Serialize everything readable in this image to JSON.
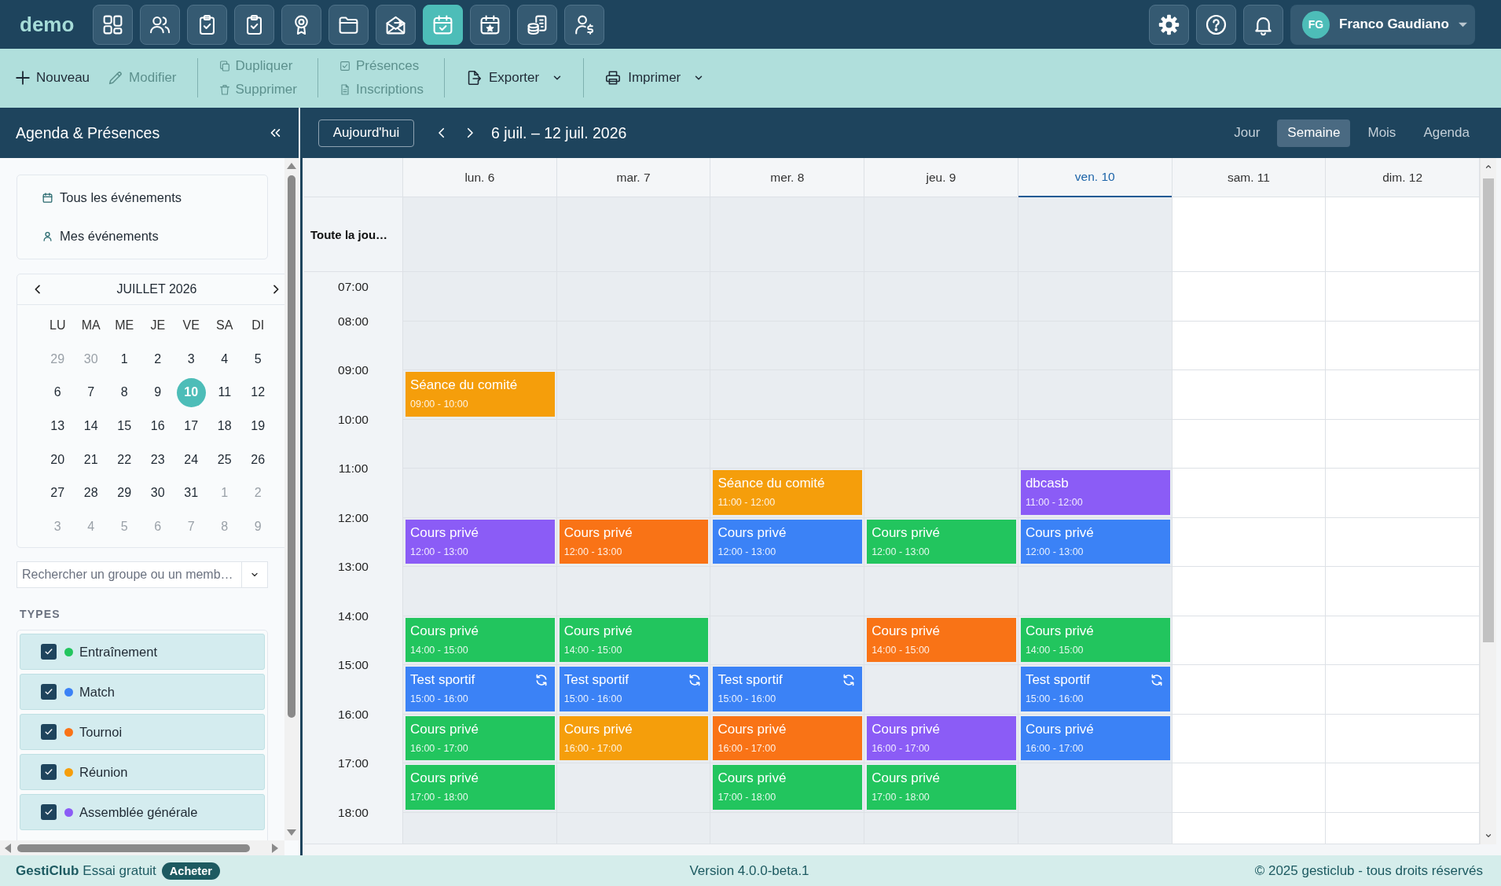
{
  "app_bar": {
    "logo": "demo",
    "modules": [
      {
        "selected": false
      },
      {
        "selected": false
      },
      {
        "selected": false
      },
      {
        "selected": false
      },
      {
        "selected": false
      },
      {
        "selected": false
      },
      {
        "selected": false
      },
      {
        "selected": true
      },
      {
        "selected": false
      },
      {
        "selected": false
      },
      {
        "selected": false
      }
    ],
    "user": {
      "initials": "FG",
      "name": "Franco Gaudiano"
    }
  },
  "toolbar": {
    "groups": [
      {
        "kind": "row",
        "buttons": [
          {
            "label": "Nouveau",
            "disabled": false
          },
          {
            "label": "Modifier",
            "disabled": true
          }
        ]
      },
      {
        "kind": "stack",
        "buttons": [
          {
            "label": "Dupliquer",
            "disabled": true
          },
          {
            "label": "Supprimer",
            "disabled": true
          }
        ]
      },
      {
        "kind": "stack",
        "buttons": [
          {
            "label": "Présences",
            "disabled": true
          },
          {
            "label": "Inscriptions",
            "disabled": true
          }
        ]
      },
      {
        "kind": "menu",
        "buttons": [
          {
            "label": "Exporter",
            "disabled": false
          }
        ]
      },
      {
        "kind": "menu",
        "buttons": [
          {
            "label": "Imprimer",
            "disabled": false
          }
        ]
      }
    ]
  },
  "sidebar": {
    "title": "Agenda & Présences",
    "nav": [
      {
        "label": "Tous les événements",
        "selected": false
      },
      {
        "label": "Mes événements",
        "selected": false
      }
    ],
    "mini_calendar": {
      "month": "JUILLET 2026",
      "weekdays": [
        "LU",
        "MA",
        "ME",
        "JE",
        "VE",
        "SA",
        "DI"
      ],
      "weeks": [
        [
          {
            "day": "29",
            "outside": true,
            "selected": false
          },
          {
            "day": "30",
            "outside": true,
            "selected": false
          },
          {
            "day": "1",
            "outside": false,
            "selected": false
          },
          {
            "day": "2",
            "outside": false,
            "selected": false
          },
          {
            "day": "3",
            "outside": false,
            "selected": false
          },
          {
            "day": "4",
            "outside": false,
            "selected": false
          },
          {
            "day": "5",
            "outside": false,
            "selected": false
          }
        ],
        [
          {
            "day": "6",
            "outside": false,
            "selected": false
          },
          {
            "day": "7",
            "outside": false,
            "selected": false
          },
          {
            "day": "8",
            "outside": false,
            "selected": false
          },
          {
            "day": "9",
            "outside": false,
            "selected": false
          },
          {
            "day": "10",
            "outside": false,
            "selected": true
          },
          {
            "day": "11",
            "outside": false,
            "selected": false
          },
          {
            "day": "12",
            "outside": false,
            "selected": false
          }
        ],
        [
          {
            "day": "13",
            "outside": false,
            "selected": false
          },
          {
            "day": "14",
            "outside": false,
            "selected": false
          },
          {
            "day": "15",
            "outside": false,
            "selected": false
          },
          {
            "day": "16",
            "outside": false,
            "selected": false
          },
          {
            "day": "17",
            "outside": false,
            "selected": false
          },
          {
            "day": "18",
            "outside": false,
            "selected": false
          },
          {
            "day": "19",
            "outside": false,
            "selected": false
          }
        ],
        [
          {
            "day": "20",
            "outside": false,
            "selected": false
          },
          {
            "day": "21",
            "outside": false,
            "selected": false
          },
          {
            "day": "22",
            "outside": false,
            "selected": false
          },
          {
            "day": "23",
            "outside": false,
            "selected": false
          },
          {
            "day": "24",
            "outside": false,
            "selected": false
          },
          {
            "day": "25",
            "outside": false,
            "selected": false
          },
          {
            "day": "26",
            "outside": false,
            "selected": false
          }
        ],
        [
          {
            "day": "27",
            "outside": false,
            "selected": false
          },
          {
            "day": "28",
            "outside": false,
            "selected": false
          },
          {
            "day": "29",
            "outside": false,
            "selected": false
          },
          {
            "day": "30",
            "outside": false,
            "selected": false
          },
          {
            "day": "31",
            "outside": false,
            "selected": false
          },
          {
            "day": "1",
            "outside": true,
            "selected": false
          },
          {
            "day": "2",
            "outside": true,
            "selected": false
          }
        ],
        [
          {
            "day": "3",
            "outside": true,
            "selected": false
          },
          {
            "day": "4",
            "outside": true,
            "selected": false
          },
          {
            "day": "5",
            "outside": true,
            "selected": false
          },
          {
            "day": "6",
            "outside": true,
            "selected": false
          },
          {
            "day": "7",
            "outside": true,
            "selected": false
          },
          {
            "day": "8",
            "outside": true,
            "selected": false
          },
          {
            "day": "9",
            "outside": true,
            "selected": false
          }
        ]
      ]
    },
    "search": {
      "placeholder": "Rechercher un groupe ou un memb…"
    },
    "types_heading": "TYPES",
    "types": [
      {
        "label": "Entraînement",
        "color": "#22c55e",
        "checked": true
      },
      {
        "label": "Match",
        "color": "#3b82f6",
        "checked": true
      },
      {
        "label": "Tournoi",
        "color": "#f97316",
        "checked": true
      },
      {
        "label": "Réunion",
        "color": "#f59e0b",
        "checked": true
      },
      {
        "label": "Assemblée générale",
        "color": "#8b5cf6",
        "checked": true
      }
    ]
  },
  "calendar": {
    "today_button": "Aujourd'hui",
    "range": "6 juil. – 12 juil. 2026",
    "views": [
      {
        "label": "Jour",
        "selected": false
      },
      {
        "label": "Semaine",
        "selected": true
      },
      {
        "label": "Mois",
        "selected": false
      },
      {
        "label": "Agenda",
        "selected": false
      }
    ],
    "all_day_label": "Toute la jou…",
    "hours": [
      "07:00",
      "08:00",
      "09:00",
      "10:00",
      "11:00",
      "12:00",
      "13:00",
      "14:00",
      "15:00",
      "16:00",
      "17:00",
      "18:00"
    ],
    "days": [
      {
        "label": "lun. 6",
        "today": false,
        "weekend": false,
        "events": [
          {
            "title": "Séance du comité",
            "time": "09:00 - 10:00",
            "color": "#f59e0b",
            "recurring": false
          },
          {
            "title": "Cours privé",
            "time": "12:00 - 13:00",
            "color": "#8b5cf6",
            "recurring": false
          },
          {
            "title": "Cours privé",
            "time": "14:00 - 15:00",
            "color": "#22c55e",
            "recurring": false
          },
          {
            "title": "Test sportif",
            "time": "15:00 - 16:00",
            "color": "#3b82f6",
            "recurring": true
          },
          {
            "title": "Cours privé",
            "time": "16:00 - 17:00",
            "color": "#22c55e",
            "recurring": false
          },
          {
            "title": "Cours privé",
            "time": "17:00 - 18:00",
            "color": "#22c55e",
            "recurring": false
          }
        ]
      },
      {
        "label": "mar. 7",
        "today": false,
        "weekend": false,
        "events": [
          {
            "title": "Cours privé",
            "time": "12:00 - 13:00",
            "color": "#f97316",
            "recurring": false
          },
          {
            "title": "Cours privé",
            "time": "14:00 - 15:00",
            "color": "#22c55e",
            "recurring": false
          },
          {
            "title": "Test sportif",
            "time": "15:00 - 16:00",
            "color": "#3b82f6",
            "recurring": true
          },
          {
            "title": "Cours privé",
            "time": "16:00 - 17:00",
            "color": "#f59e0b",
            "recurring": false
          }
        ]
      },
      {
        "label": "mer. 8",
        "today": false,
        "weekend": false,
        "events": [
          {
            "title": "Séance du comité",
            "time": "11:00 - 12:00",
            "color": "#f59e0b",
            "recurring": false
          },
          {
            "title": "Cours privé",
            "time": "12:00 - 13:00",
            "color": "#3b82f6",
            "recurring": false
          },
          {
            "title": "Test sportif",
            "time": "15:00 - 16:00",
            "color": "#3b82f6",
            "recurring": true
          },
          {
            "title": "Cours privé",
            "time": "16:00 - 17:00",
            "color": "#f97316",
            "recurring": false
          },
          {
            "title": "Cours privé",
            "time": "17:00 - 18:00",
            "color": "#22c55e",
            "recurring": false
          }
        ]
      },
      {
        "label": "jeu. 9",
        "today": false,
        "weekend": false,
        "events": [
          {
            "title": "Cours privé",
            "time": "12:00 - 13:00",
            "color": "#22c55e",
            "recurring": false
          },
          {
            "title": "Cours privé",
            "time": "14:00 - 15:00",
            "color": "#f97316",
            "recurring": false
          },
          {
            "title": "Cours privé",
            "time": "16:00 - 17:00",
            "color": "#8b5cf6",
            "recurring": false
          },
          {
            "title": "Cours privé",
            "time": "17:00 - 18:00",
            "color": "#22c55e",
            "recurring": false
          }
        ]
      },
      {
        "label": "ven. 10",
        "today": true,
        "weekend": false,
        "events": [
          {
            "title": "dbcasb",
            "time": "11:00 - 12:00",
            "color": "#8b5cf6",
            "recurring": false
          },
          {
            "title": "Cours privé",
            "time": "12:00 - 13:00",
            "color": "#3b82f6",
            "recurring": false
          },
          {
            "title": "Cours privé",
            "time": "14:00 - 15:00",
            "color": "#22c55e",
            "recurring": false
          },
          {
            "title": "Test sportif",
            "time": "15:00 - 16:00",
            "color": "#3b82f6",
            "recurring": true
          },
          {
            "title": "Cours privé",
            "time": "16:00 - 17:00",
            "color": "#3b82f6",
            "recurring": false
          }
        ]
      },
      {
        "label": "sam. 11",
        "today": false,
        "weekend": true
      },
      {
        "label": "dim. 12",
        "today": false,
        "weekend": true
      }
    ]
  },
  "footer": {
    "brand": "GestiClub",
    "trial": "Essai gratuit",
    "buy_button": "Acheter",
    "version": "Version 4.0.0-beta.1",
    "copyright": "© 2025 gesticlub - tous droits réservés"
  }
}
